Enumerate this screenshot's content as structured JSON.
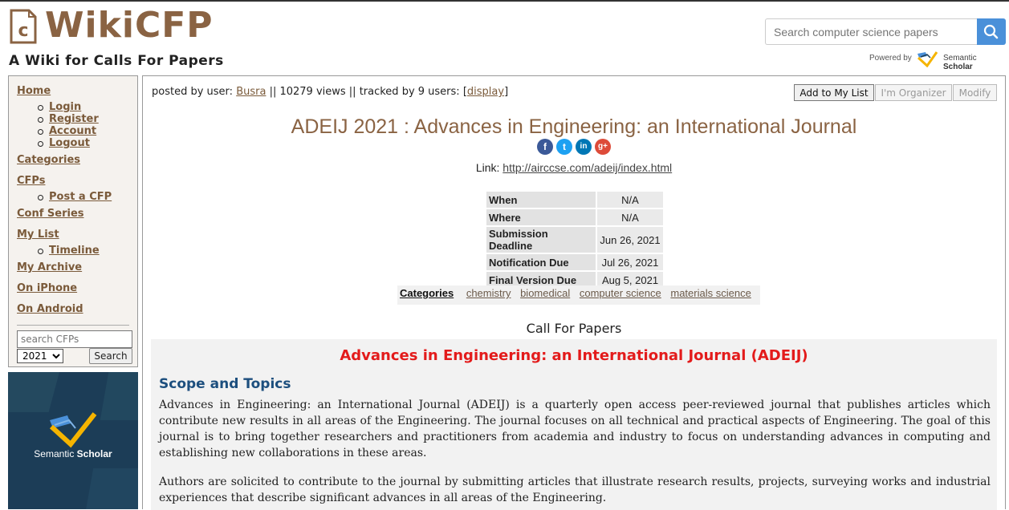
{
  "header": {
    "logo_text": "WikiCFP",
    "tagline": "A Wiki for Calls For Papers",
    "search_placeholder": "Search computer science papers",
    "powered_by": "Powered by",
    "semantic": "Semantic",
    "scholar": "Scholar"
  },
  "sidebar": {
    "home": "Home",
    "login": "Login",
    "register": "Register",
    "account": "Account",
    "logout": "Logout",
    "categories": "Categories",
    "cfps": "CFPs",
    "post_cfp": "Post a CFP",
    "conf_series": "Conf Series",
    "my_list": "My List",
    "timeline": "Timeline",
    "my_archive": "My Archive",
    "on_iphone": "On iPhone",
    "on_android": "On Android",
    "search_placeholder": "search CFPs",
    "year": "2021",
    "search_button": "Search",
    "ad_semantic": "Semantic",
    "ad_scholar": "Scholar"
  },
  "posted": {
    "prefix": "posted by user:",
    "user": "Busra",
    "views": "|| 10279 views || tracked by 9 users: [",
    "display": "display",
    "suffix": "]"
  },
  "actions": {
    "add": "Add to My List",
    "organizer": "I'm Organizer",
    "modify": "Modify"
  },
  "event": {
    "title": "ADEIJ 2021 : Advances in Engineering: an International Journal",
    "link_label": "Link:",
    "link": "http://airccse.com/adeij/index.html",
    "info": [
      {
        "k": "When",
        "v": "N/A"
      },
      {
        "k": "Where",
        "v": "N/A"
      },
      {
        "k": "Submission Deadline",
        "v": "Jun 26, 2021"
      },
      {
        "k": "Notification Due",
        "v": "Jul 26, 2021"
      },
      {
        "k": "Final Version Due",
        "v": "Aug 5, 2021"
      }
    ],
    "categories_label": "Categories",
    "categories": [
      "chemistry",
      "biomedical",
      "computer science",
      "materials science"
    ]
  },
  "cfp": {
    "heading": "Call For Papers",
    "title": "Advances in Engineering: an International Journal (ADEIJ)",
    "scope": "Scope and Topics",
    "para1": "Advances in Engineering: an International Journal (ADEIJ) is a quarterly open access peer-reviewed journal that publishes articles which contribute new results in all areas of the Engineering. The journal focuses on all technical and practical aspects of Engineering. The goal of this journal is to bring together researchers and practitioners from academia and industry to focus on understanding advances in computing and establishing new collaborations in these areas.",
    "para2": "Authors are solicited to contribute to the journal by submitting articles that illustrate research results, projects, surveying works and industrial experiences that describe significant advances in all areas of the Engineering."
  },
  "share": {
    "facebook": "f",
    "twitter": "t",
    "linkedin": "in",
    "google": "g+"
  },
  "colors": {
    "brand": "#8a6343",
    "cfp_title": "#e31b1b",
    "scope": "#1d4f7e",
    "search_button": "#4a90d9"
  }
}
